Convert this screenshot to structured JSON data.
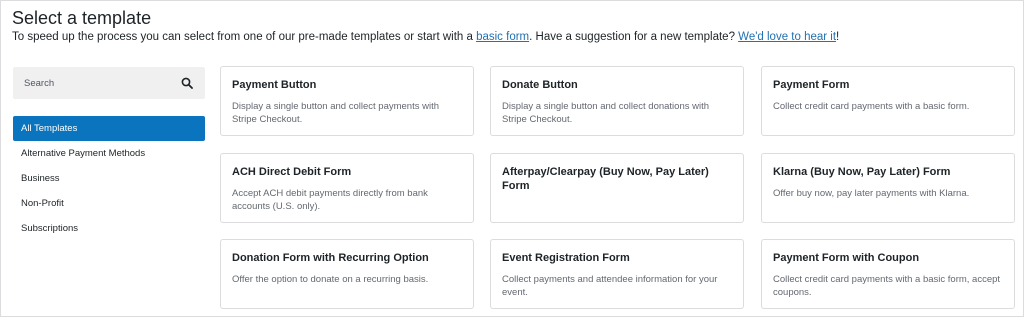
{
  "header": {
    "title": "Select a template",
    "subtitle_before": "To speed up the process you can select from one of our pre-made templates or start with a ",
    "basic_form_link": "basic form",
    "subtitle_middle": ". Have a suggestion for a new template? ",
    "suggest_link": "We'd love to hear it",
    "subtitle_end": "!"
  },
  "search": {
    "placeholder": "Search",
    "value": ""
  },
  "categories": [
    {
      "label": "All Templates",
      "active": true
    },
    {
      "label": "Alternative Payment Methods"
    },
    {
      "label": "Business"
    },
    {
      "label": "Non-Profit"
    },
    {
      "label": "Subscriptions"
    }
  ],
  "templates": [
    {
      "title": "Payment Button",
      "desc": "Display a single button and collect payments with Stripe Checkout."
    },
    {
      "title": "Donate Button",
      "desc": "Display a single button and collect donations with Stripe Checkout."
    },
    {
      "title": "Payment Form",
      "desc": "Collect credit card payments with a basic form."
    },
    {
      "title": "ACH Direct Debit Form",
      "desc": "Accept ACH debit payments directly from bank accounts (U.S. only)."
    },
    {
      "title": "Afterpay/Clearpay (Buy Now, Pay Later) Form",
      "desc": ""
    },
    {
      "title": "Klarna (Buy Now, Pay Later) Form",
      "desc": "Offer buy now, pay later payments with Klarna."
    },
    {
      "title": "Donation Form with Recurring Option",
      "desc": "Offer the option to donate on a recurring basis."
    },
    {
      "title": "Event Registration Form",
      "desc": "Collect payments and attendee information for your event."
    },
    {
      "title": "Payment Form with Coupon",
      "desc": "Collect credit card payments with a basic form, accept coupons."
    }
  ],
  "colors": {
    "accent": "#0a75be",
    "link": "#2271b1",
    "border": "#dcdcde"
  }
}
